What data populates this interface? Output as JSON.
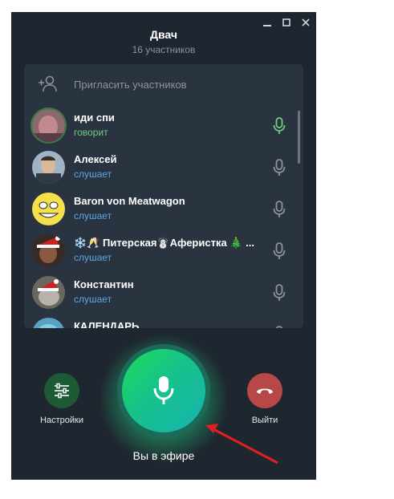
{
  "window": {
    "title": "Двач",
    "subtitle": "16 участников",
    "controls": [
      "minimize-icon",
      "maximize-icon",
      "close-icon"
    ]
  },
  "invite": {
    "label": "Пригласить участников",
    "icon": "add-user-icon"
  },
  "participants": [
    {
      "name": "иди спи",
      "status": "говорит",
      "speaking": true,
      "mic_color": "#6ad07e"
    },
    {
      "name": "Алексей",
      "status": "слушает",
      "speaking": false,
      "mic_color": "#8b949e"
    },
    {
      "name": "Baron von Meatwagon",
      "status": "слушает",
      "speaking": false,
      "mic_color": "#8b949e"
    },
    {
      "name": "❄️🥂 Питерская☃️Аферистка 🎄 ...",
      "status": "слушает",
      "speaking": false,
      "mic_color": "#8b949e"
    },
    {
      "name": "Константин",
      "status": "слушает",
      "speaking": false,
      "mic_color": "#8b949e"
    },
    {
      "name": "КАЛЕНДАРЬ",
      "status": "",
      "speaking": false,
      "mic_color": "#8b949e"
    }
  ],
  "controls": {
    "settings_label": "Настройки",
    "leave_label": "Выйти",
    "live_label": "Вы в эфире"
  },
  "colors": {
    "window_bg": "#1e2630",
    "panel_bg": "#2a3340",
    "speaking_green": "#6ad07e",
    "listening_blue": "#58a8e6",
    "leave_red": "#b84747",
    "settings_green": "#1f5a37",
    "annotation_arrow": "#e02020"
  }
}
